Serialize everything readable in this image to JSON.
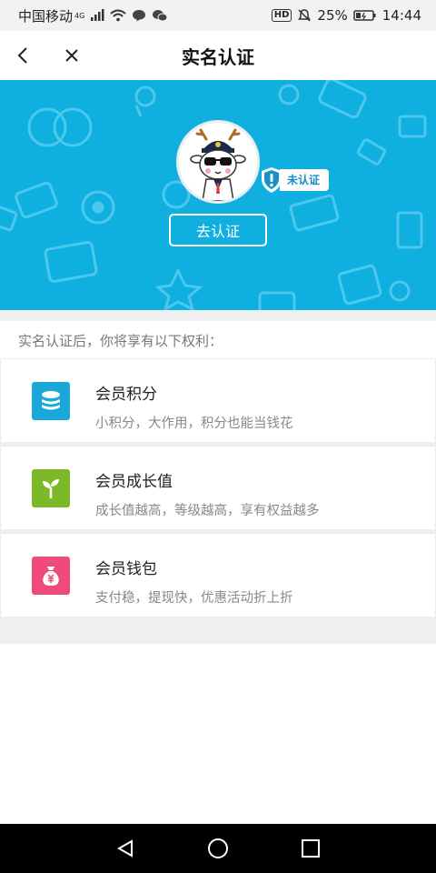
{
  "status_bar": {
    "carrier": "中国移动",
    "network": "4G",
    "hd": "HD",
    "battery": "25%",
    "time": "14:44"
  },
  "header": {
    "title": "实名认证"
  },
  "banner": {
    "badge": "未认证",
    "verify_button": "去认证",
    "bg_color": "#0fb0e0"
  },
  "intro": "实名认证后，你将享有以下权利：",
  "benefits": [
    {
      "title": "会员积分",
      "desc": "小积分，大作用，积分也能当钱花",
      "icon": "coins-icon",
      "color": "#1aa8d8"
    },
    {
      "title": "会员成长值",
      "desc": "成长值越高，等级越高，享有权益越多",
      "icon": "sprout-icon",
      "color": "#7cb929"
    },
    {
      "title": "会员钱包",
      "desc": "支付稳，提现快，优惠活动折上折",
      "icon": "money-bag-icon",
      "color": "#ee4b7b"
    }
  ]
}
